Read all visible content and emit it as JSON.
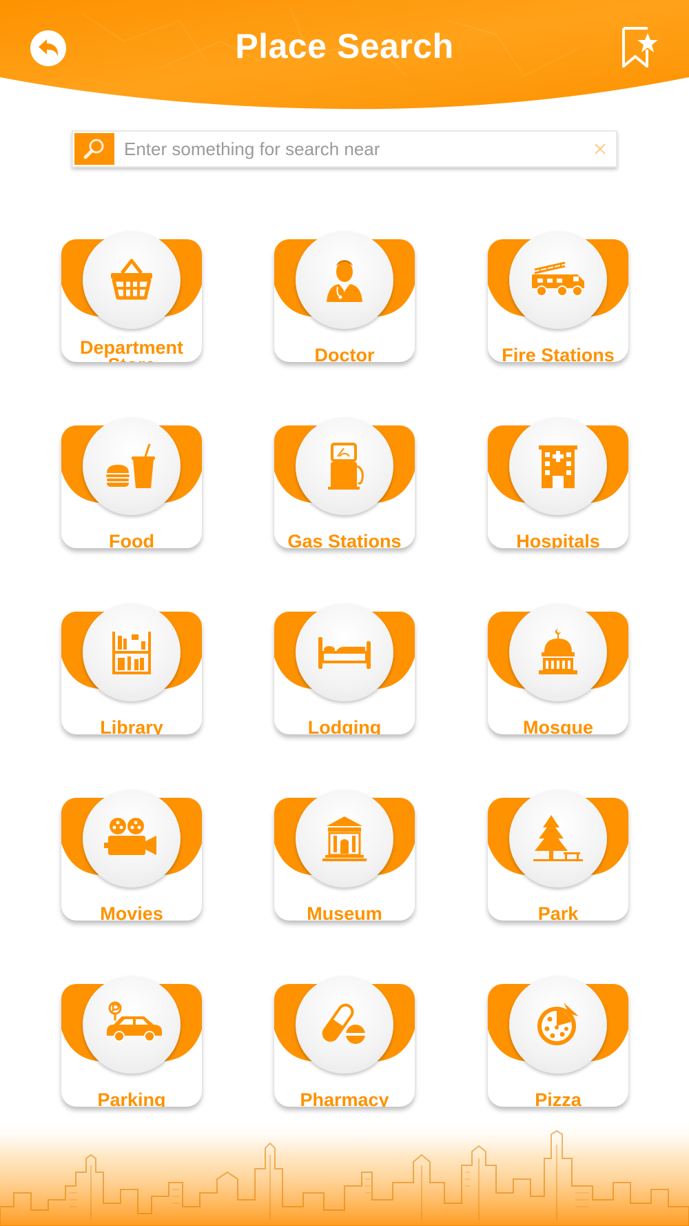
{
  "header": {
    "title": "Place Search",
    "back_icon": "back-arrow-icon",
    "favorites_icon": "bookmark-star-icon"
  },
  "search": {
    "placeholder": "Enter something for search near",
    "value": "",
    "search_icon": "magnifier-icon",
    "clear_icon": "close-icon"
  },
  "categories": [
    {
      "label_lines": [
        "Department",
        "Store"
      ],
      "icon": "shopping-basket-icon"
    },
    {
      "label_lines": [
        "Doctor"
      ],
      "icon": "doctor-icon"
    },
    {
      "label_lines": [
        "Fire Stations"
      ],
      "icon": "fire-truck-icon"
    },
    {
      "label_lines": [
        "Food"
      ],
      "icon": "burger-drink-icon"
    },
    {
      "label_lines": [
        "Gas Stations"
      ],
      "icon": "gas-pump-icon"
    },
    {
      "label_lines": [
        "Hospitals"
      ],
      "icon": "hospital-building-icon"
    },
    {
      "label_lines": [
        "Library"
      ],
      "icon": "bookshelf-icon"
    },
    {
      "label_lines": [
        "Lodging"
      ],
      "icon": "bed-icon"
    },
    {
      "label_lines": [
        "Mosque"
      ],
      "icon": "mosque-dome-icon"
    },
    {
      "label_lines": [
        "Movies"
      ],
      "icon": "movie-camera-icon"
    },
    {
      "label_lines": [
        "Museum"
      ],
      "icon": "museum-icon"
    },
    {
      "label_lines": [
        "Park"
      ],
      "icon": "pine-tree-bench-icon"
    },
    {
      "label_lines": [
        "Parking"
      ],
      "icon": "parking-car-icon"
    },
    {
      "label_lines": [
        "Pharmacy"
      ],
      "icon": "pill-capsule-icon"
    },
    {
      "label_lines": [
        "Pizza"
      ],
      "icon": "pizza-icon"
    }
  ],
  "colors": {
    "accent": "#fe9200",
    "accent_light": "#ffb13c",
    "text_on_accent": "#ffffff"
  }
}
